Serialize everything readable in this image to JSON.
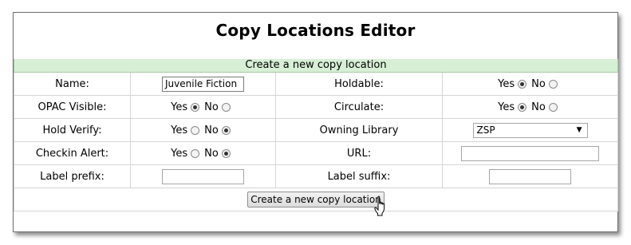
{
  "window": {
    "title": "Copy Locations Editor"
  },
  "form": {
    "header": "Create a new copy location",
    "fields": {
      "name": {
        "label": "Name:",
        "value": "Juvenile Fiction"
      },
      "holdable": {
        "label": "Holdable:",
        "yes": "Yes",
        "no": "No",
        "selected": "yes"
      },
      "opac_visible": {
        "label": "OPAC Visible:",
        "yes": "Yes",
        "no": "No",
        "selected": "yes"
      },
      "circulate": {
        "label": "Circulate:",
        "yes": "Yes",
        "no": "No",
        "selected": "yes"
      },
      "hold_verify": {
        "label": "Hold Verify:",
        "yes": "Yes",
        "no": "No",
        "selected": "no"
      },
      "owning_library": {
        "label": "Owning Library",
        "value": "ZSP"
      },
      "checkin_alert": {
        "label": "Checkin Alert:",
        "yes": "Yes",
        "no": "No",
        "selected": "no"
      },
      "url": {
        "label": "URL:",
        "value": ""
      },
      "label_prefix": {
        "label": "Label prefix:",
        "value": ""
      },
      "label_suffix": {
        "label": "Label suffix:",
        "value": ""
      }
    },
    "submit_label": "Create a new copy location"
  }
}
